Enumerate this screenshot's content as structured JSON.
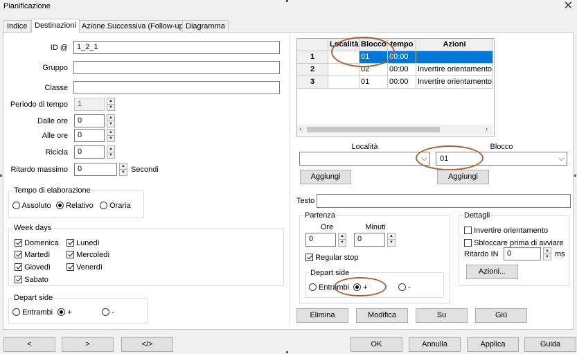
{
  "window": {
    "title": "Pianificazione"
  },
  "tabs": [
    "Indice",
    "Destinazioni",
    "Azione Successiva (Follow-up)",
    "Diagramma"
  ],
  "form": {
    "id_label": "ID @",
    "id_value": "1_2_1",
    "gruppo_label": "Gruppo",
    "gruppo_value": "",
    "classe_label": "Classe",
    "classe_value": "",
    "periodo_label": "Periodo di tempo",
    "periodo_value": "1",
    "dalle_label": "Dalle ore",
    "dalle_value": "0",
    "alle_label": "Alle ore",
    "alle_value": "0",
    "ricicla_label": "Ricicla",
    "ricicla_value": "0",
    "ritardo_label": "Ritardo massimo",
    "ritardo_value": "0",
    "ritardo_unit": "Secondi"
  },
  "tempo": {
    "title": "Tempo di elaborazione",
    "options": [
      "Assoluto",
      "Relativo",
      "Oraria"
    ],
    "selected": "Relativo"
  },
  "weekdays": {
    "title": "Week days",
    "days": [
      {
        "label": "Domenica",
        "checked": true
      },
      {
        "label": "Lunedì",
        "checked": true
      },
      {
        "label": "Martedì",
        "checked": true
      },
      {
        "label": "Mercoledì",
        "checked": true
      },
      {
        "label": "Giovedì",
        "checked": true
      },
      {
        "label": "Venerdì",
        "checked": true
      },
      {
        "label": "Sabato",
        "checked": true
      }
    ]
  },
  "depart_left": {
    "title": "Depart side",
    "options": [
      "Entrambi",
      "+",
      "-"
    ],
    "selected": "+"
  },
  "grid": {
    "headers": [
      "",
      "Località",
      "Blocco",
      "tempo",
      "Azioni"
    ],
    "rows": [
      {
        "n": "1",
        "localita": "",
        "blocco": "01",
        "tempo": "00:00",
        "azioni": "",
        "selected": true
      },
      {
        "n": "2",
        "localita": "",
        "blocco": "02",
        "tempo": "00:00",
        "azioni": "Invertire orientamento",
        "selected": false
      },
      {
        "n": "3",
        "localita": "",
        "blocco": "01",
        "tempo": "00:00",
        "azioni": "Invertire orientamento",
        "selected": false
      }
    ]
  },
  "localita": {
    "label": "Località",
    "value": "",
    "add_button": "Aggiungi"
  },
  "blocco": {
    "label": "Blocco",
    "value": "01",
    "add_button": "Aggiungi"
  },
  "testo": {
    "label": "Testo",
    "value": ""
  },
  "partenza": {
    "title": "Partenza",
    "ore_label": "Ore",
    "ore_value": "0",
    "minuti_label": "Minuti",
    "minuti_value": "0",
    "regular_stop_label": "Regular stop",
    "regular_stop_checked": true,
    "depart_title": "Depart side",
    "depart_options": [
      "Entrambi",
      "+",
      "-"
    ],
    "depart_selected": "+"
  },
  "dettagli": {
    "title": "Dettagli",
    "invertire_label": "Invertire orientamento",
    "invertire_checked": false,
    "sbloccare_label": "Sbloccare prima di avviare",
    "sbloccare_checked": false,
    "ritardo_in_label": "Ritardo IN",
    "ritardo_in_value": "0",
    "ritardo_in_unit": "ms",
    "azioni_button": "Azioni..."
  },
  "row_buttons": [
    "Elimina",
    "Modifica",
    "Su",
    "Giù"
  ],
  "footer": {
    "nav_buttons": [
      "<",
      ">",
      "</>"
    ],
    "dialog_buttons": [
      "OK",
      "Annulla",
      "Applica",
      "Guida"
    ]
  },
  "colors": {
    "selection": "#0078d7",
    "highlight_oval": "#b06030"
  }
}
